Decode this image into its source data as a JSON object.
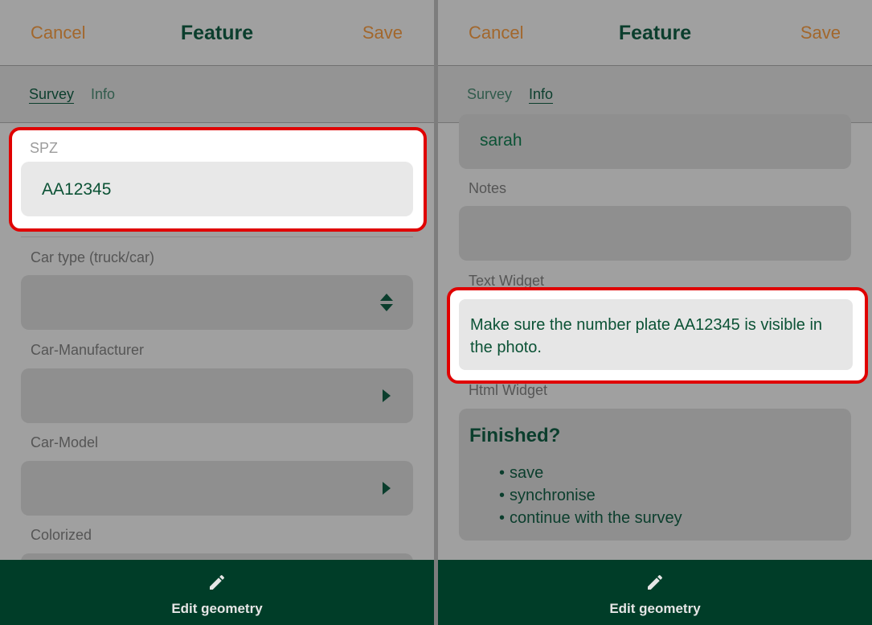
{
  "header": {
    "cancel_label": "Cancel",
    "title": "Feature",
    "save_label": "Save"
  },
  "tabs": [
    {
      "label": "Survey"
    },
    {
      "label": "Info"
    }
  ],
  "left": {
    "spz_label": "SPZ",
    "spz_value": "AA12345",
    "car_type_label": "Car type (truck/car)",
    "car_manufacturer_label": "Car-Manufacturer",
    "car_model_label": "Car-Model",
    "colorized_label": "Colorized"
  },
  "right": {
    "user_value": "sarah",
    "notes_label": "Notes",
    "text_widget_label": "Text Widget",
    "text_widget_value": "Make sure the number plate AA12345 is visible in the photo.",
    "html_widget_label": "Html Widget",
    "html_title": "Finished?",
    "html_items": [
      "save",
      "synchronise",
      "continue with the survey"
    ]
  },
  "footer": {
    "edit_geometry_label": "Edit geometry",
    "icon": "pencil-icon"
  },
  "colors": {
    "accent_orange": "#a2672c",
    "brand_green": "#003d28",
    "highlight_red": "#e00000"
  }
}
